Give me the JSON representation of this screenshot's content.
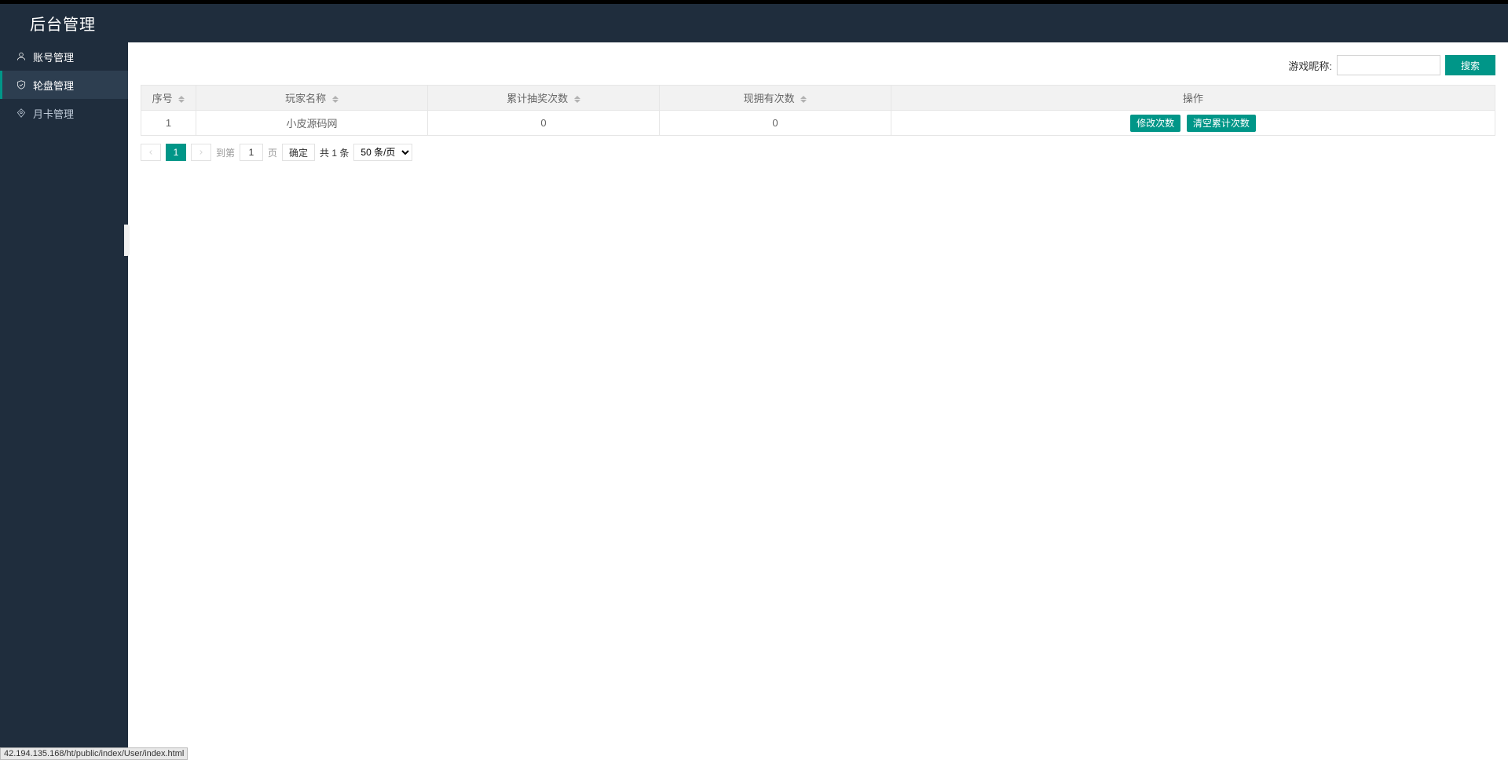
{
  "header": {
    "title": "后台管理"
  },
  "sidebar": {
    "items": [
      {
        "label": "账号管理",
        "icon": "user"
      },
      {
        "label": "轮盘管理",
        "icon": "shield"
      },
      {
        "label": "月卡管理",
        "icon": "diamond"
      }
    ]
  },
  "search": {
    "label": "游戏昵称:",
    "value": "",
    "button": "搜索"
  },
  "table": {
    "headers": [
      "序号",
      "玩家名称",
      "累计抽奖次数",
      "现拥有次数",
      "操作"
    ],
    "rows": [
      {
        "seq": "1",
        "name": "小皮源码网",
        "cumulative": "0",
        "owned": "0"
      }
    ],
    "ops": {
      "edit": "修改次数",
      "clear": "清空累计次数"
    }
  },
  "pagination": {
    "current": "1",
    "goto_prefix": "到第",
    "goto_value": "1",
    "goto_suffix": "页",
    "confirm": "确定",
    "total": "共 1 条",
    "page_size": "50 条/页"
  },
  "status_url": "42.194.135.168/ht/public/index/User/index.html"
}
